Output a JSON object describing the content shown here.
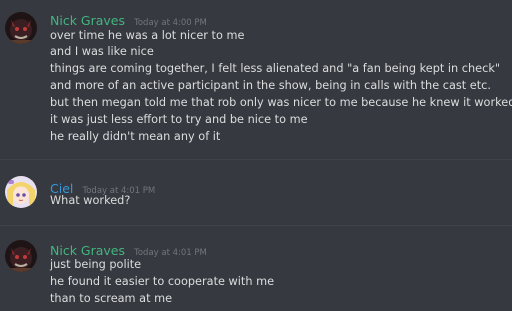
{
  "groups": [
    {
      "author": "Nick Graves",
      "author_color": "#43b581",
      "timestamp": "Today at 4:00 PM",
      "avatar_icon": "dark-horned-character-avatar-icon",
      "lines": [
        "over time he was a lot nicer to me",
        "and I was like nice",
        "things are coming together, I felt less alienated and \"a fan being kept in check\"",
        "and more of an active participant in the show, being in calls with the cast etc.",
        "but then megan told me that rob only was nicer to me because he knew it worked",
        "it was just less effort to try and be nice to me",
        "he really didn't mean any of it"
      ]
    },
    {
      "author": "Ciel",
      "author_color": "#3498db",
      "timestamp": "Today at 4:01 PM",
      "avatar_icon": "blonde-anime-girl-avatar-icon",
      "lines": [
        "What worked?"
      ]
    },
    {
      "author": "Nick Graves",
      "author_color": "#43b581",
      "timestamp": "Today at 4:01 PM",
      "avatar_icon": "dark-horned-character-avatar-icon",
      "lines": [
        "just being polite",
        "he found it easier to cooperate with me",
        "than to scream at me"
      ]
    }
  ]
}
